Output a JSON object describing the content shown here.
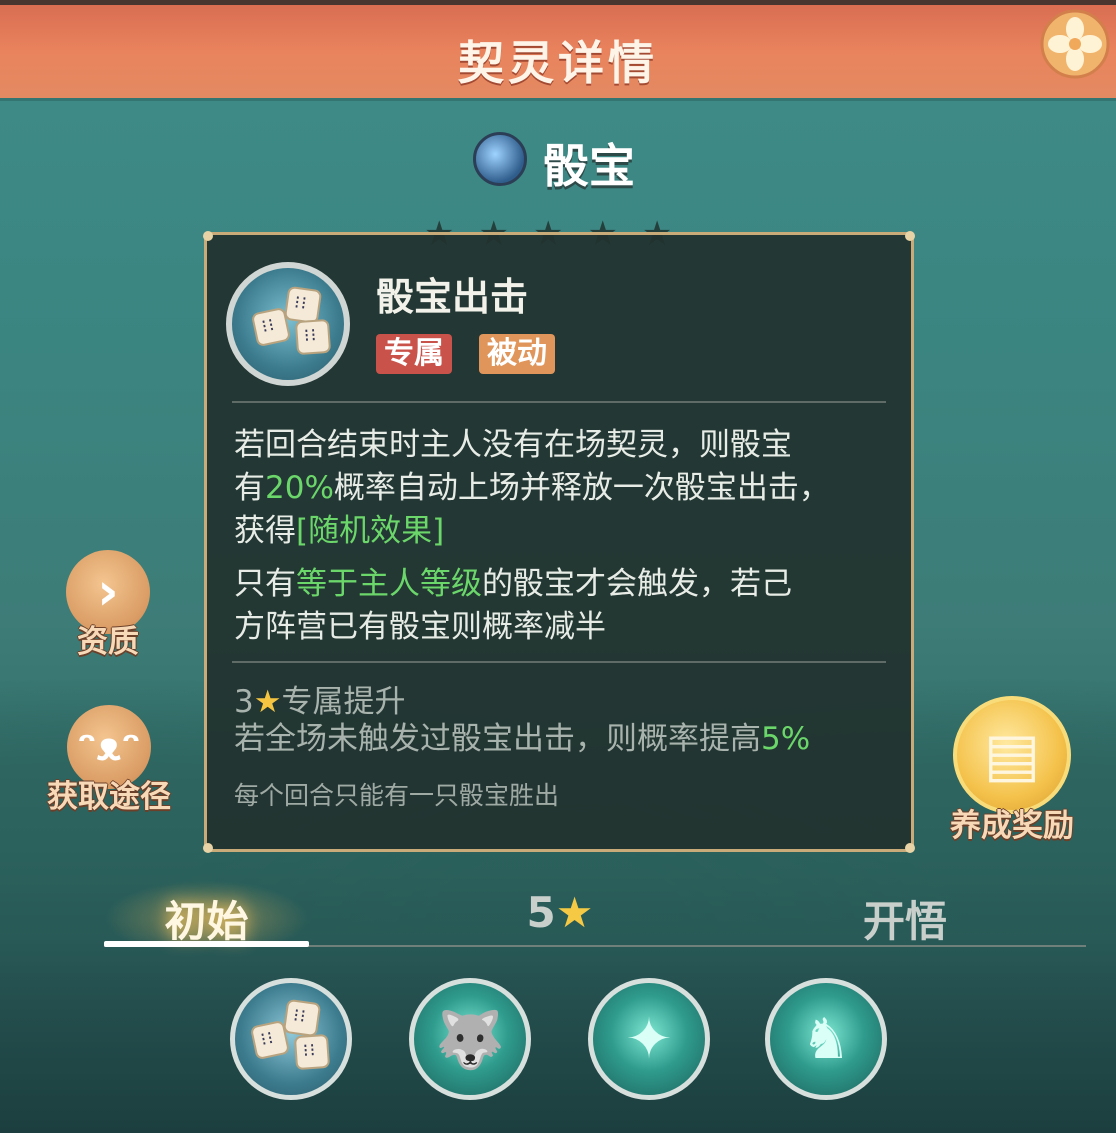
{
  "header": {
    "title": "契灵详情"
  },
  "pet": {
    "name": "骰宝",
    "type_icon": "element-wind-icon",
    "stars": "★★★★★"
  },
  "skill": {
    "name": "骰宝出击",
    "tags": [
      "专属",
      "被动"
    ],
    "desc1_a": "若回合结束时主人没有在场契灵，则骰宝",
    "desc1_b": "有",
    "desc1_pct": "20%",
    "desc1_c": "概率自动上场并释放一次骰宝出击，",
    "desc1_d": "获得",
    "desc1_link": "[随机效果]",
    "desc2_a": "只有",
    "desc2_green": "等于主人等级",
    "desc2_b": "的骰宝才会触发，若己",
    "desc2_c": "方阵营已有骰宝则概率减半",
    "upgrade_stars": "3",
    "upgrade_title": "专属提升",
    "upgrade_desc": "若全场未触发过骰宝出击，则概率提高",
    "upgrade_pct": "5%",
    "note": "每个回合只能有一只骰宝胜出"
  },
  "side": {
    "aptitude_label": "资质",
    "source_label": "获取途径",
    "reward_label": "养成奖励"
  },
  "tabs": {
    "initial": "初始",
    "five_star_num": "5",
    "awaken": "开悟"
  },
  "skill_slots": [
    "dice-skill-icon",
    "wolf-skill-icon",
    "burst-skill-icon",
    "beast-skill-icon"
  ],
  "colors": {
    "accent_green": "#6bd66a",
    "header": "#e9835d",
    "panel_border": "#c8ab78"
  }
}
